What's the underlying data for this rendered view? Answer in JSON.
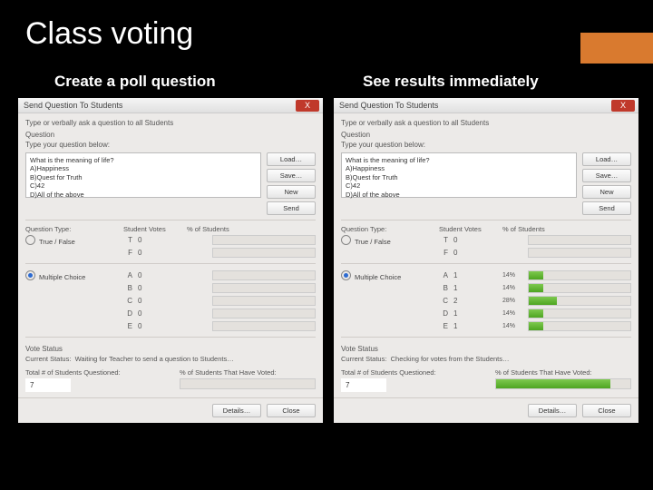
{
  "title": "Class voting",
  "subheads": {
    "left": "Create a poll question",
    "right": "See results immediately"
  },
  "window": {
    "title": "Send Question To Students",
    "close": "X",
    "hint": "Type or verbally ask a question to all Students",
    "group": "Question",
    "type_label": "Type your question below:",
    "question_text": "What is the meaning of life?\nA)Happiness\nB)Quest for Truth\nC)42\nD)All of the above",
    "buttons": {
      "load": "Load…",
      "save": "Save…",
      "new": "New",
      "send": "Send"
    },
    "columns": {
      "type": "Question Type:",
      "votes": "Student Votes",
      "pct": "% of Students"
    },
    "options": {
      "true_false": "True / False",
      "multiple_choice": "Multiple Choice"
    },
    "tf_labels": [
      "T",
      "F"
    ],
    "mc_labels": [
      "A",
      "B",
      "C",
      "D",
      "E"
    ],
    "vote_status_head": "Vote Status",
    "status_label": "Current Status:",
    "footer": {
      "total_label": "Total # of Students Questioned:",
      "pct_label": "% of Students That Have Voted:"
    },
    "details": "Details…",
    "close_btn": "Close"
  },
  "left": {
    "selected": "multiple_choice",
    "tf_votes": [
      0,
      0
    ],
    "mc_votes": [
      0,
      0,
      0,
      0,
      0
    ],
    "mc_pct": [
      "",
      "",
      "",
      "",
      ""
    ],
    "mc_bar_pct": [
      0,
      0,
      0,
      0,
      0
    ],
    "status": "Waiting for Teacher to send a question to Students…",
    "total": "7",
    "voted_pct": 0
  },
  "right": {
    "selected": "multiple_choice",
    "tf_votes": [
      0,
      0
    ],
    "mc_votes": [
      1,
      1,
      2,
      1,
      1
    ],
    "mc_pct": [
      "14%",
      "14%",
      "28%",
      "14%",
      "14%"
    ],
    "mc_bar_pct": [
      14,
      14,
      28,
      14,
      14
    ],
    "status": "Checking for votes from the Students…",
    "total": "7",
    "voted_pct": 85
  }
}
